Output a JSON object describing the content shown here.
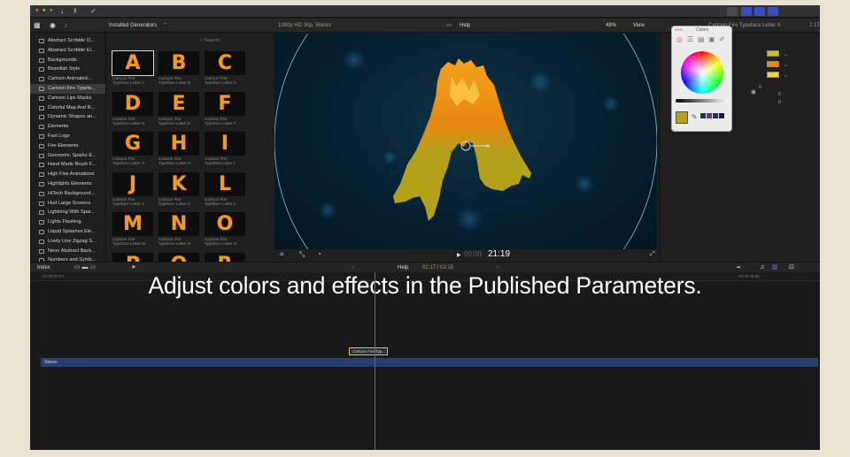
{
  "titlebar": {
    "left_icons": [
      "download-icon",
      "key-icon",
      "check-icon"
    ],
    "right_icons": [
      "workspace-icon",
      "browser-toggle-icon",
      "timeline-toggle-icon",
      "inspector-toggle-icon"
    ]
  },
  "toolbar": {
    "browser_title": "Installed Generators",
    "search_placeholder": "Search",
    "viewer_format": "1080p HD 30p, Stereo",
    "viewer_title": "Help",
    "zoom": "48%",
    "view_label": "View",
    "inspector_title": "Cartoon Fire Typeface Letter A",
    "inspector_duration": "2:17"
  },
  "sidebar": {
    "items": [
      {
        "label": "Abstract Scribble D...",
        "selected": false
      },
      {
        "label": "Abstract Scribble El...",
        "selected": false
      },
      {
        "label": "Backgrounds",
        "selected": false
      },
      {
        "label": "Bismillah Style",
        "selected": false
      },
      {
        "label": "Cartoon Animated...",
        "selected": false
      },
      {
        "label": "Cartoon Fire Typefa...",
        "selected": true
      },
      {
        "label": "Cartoon Lips Masks",
        "selected": false
      },
      {
        "label": "Colorful Map And R...",
        "selected": false
      },
      {
        "label": "Dynamic Shapes an...",
        "selected": false
      },
      {
        "label": "Elements",
        "selected": false
      },
      {
        "label": "Fast Logo",
        "selected": false
      },
      {
        "label": "Fire Elements",
        "selected": false
      },
      {
        "label": "Geometric Sparks E...",
        "selected": false
      },
      {
        "label": "Hand Made Brush F...",
        "selected": false
      },
      {
        "label": "High Five Animations",
        "selected": false
      },
      {
        "label": "Highlights Elements",
        "selected": false
      },
      {
        "label": "HiTech Background...",
        "selected": false
      },
      {
        "label": "Hud Large Screens",
        "selected": false
      },
      {
        "label": "Lightning With Spar...",
        "selected": false
      },
      {
        "label": "Lights Flashing",
        "selected": false
      },
      {
        "label": "Liquid Splashes Ele...",
        "selected": false
      },
      {
        "label": "Lively Line Zigzag S...",
        "selected": false
      },
      {
        "label": "Neon Abstract Back...",
        "selected": false
      },
      {
        "label": "Numbers and Symb...",
        "selected": false
      }
    ]
  },
  "browser": {
    "tiles": [
      {
        "letter": "A",
        "caption": "Cartoon Fire\nTypeface Letter A",
        "selected": true
      },
      {
        "letter": "B",
        "caption": "Cartoon Fire\nTypeface Letter B",
        "selected": false
      },
      {
        "letter": "C",
        "caption": "Cartoon Fire\nTypeface Letter C",
        "selected": false
      },
      {
        "letter": "D",
        "caption": "Cartoon Fire\nTypeface Letter D",
        "selected": false
      },
      {
        "letter": "E",
        "caption": "Cartoon Fire\nTypeface Letter E",
        "selected": false
      },
      {
        "letter": "F",
        "caption": "Cartoon Fire\nTypeface Letter F",
        "selected": false
      },
      {
        "letter": "G",
        "caption": "Cartoon Fire\nTypeface Letter G",
        "selected": false
      },
      {
        "letter": "H",
        "caption": "Cartoon Fire\nTypeface Letter H",
        "selected": false
      },
      {
        "letter": "I",
        "caption": "Cartoon Fire\nTypeface Letter I",
        "selected": false
      },
      {
        "letter": "J",
        "caption": "Cartoon Fire\nTypeface Letter J",
        "selected": false
      },
      {
        "letter": "K",
        "caption": "Cartoon Fire\nTypeface Letter K",
        "selected": false
      },
      {
        "letter": "L",
        "caption": "Cartoon Fire\nTypeface Letter L",
        "selected": false
      },
      {
        "letter": "M",
        "caption": "Cartoon Fire\nTypeface Letter M",
        "selected": false
      },
      {
        "letter": "N",
        "caption": "Cartoon Fire\nTypeface Letter N",
        "selected": false
      },
      {
        "letter": "O",
        "caption": "Cartoon Fire\nTypeface Letter O",
        "selected": false
      },
      {
        "letter": "P",
        "caption": "",
        "selected": false
      },
      {
        "letter": "Q",
        "caption": "",
        "selected": false
      },
      {
        "letter": "R",
        "caption": "",
        "selected": false
      }
    ]
  },
  "viewer": {
    "timecode": "21:19",
    "timecode_prefix": "00:00",
    "fire_colors": {
      "top": "#f4a31c",
      "mid": "#e8870f",
      "bottom": "#b5a01a"
    },
    "background_color": "#072233"
  },
  "timeline": {
    "index_label": "Index",
    "project_name": "Help",
    "position": "02:17 / 02:15",
    "ruler_start": "00:00:00:00",
    "ruler_end": "00:00:45:00",
    "generator_clip": "Cartoon Fire Typ...",
    "storyline_label": "Stereo"
  },
  "caption": "Adjust colors and effects in the Published Parameters.",
  "inspector": {
    "swatches": [
      "#c9c22a",
      "#e8870f",
      "#f2d04a"
    ],
    "values": [
      "0",
      "0",
      "0"
    ],
    "colors_window_title": "Colors"
  }
}
